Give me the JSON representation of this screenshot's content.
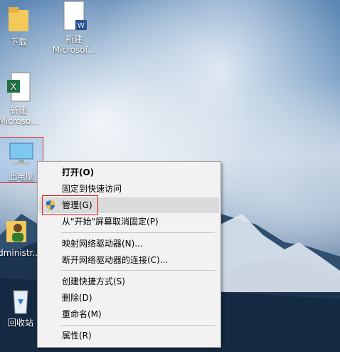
{
  "desktop": {
    "icons": [
      {
        "label": "下载",
        "kind": "folder"
      },
      {
        "label": "新建\nMicrosof...",
        "kind": "word-doc"
      },
      {
        "label": "新建\nMicroso...",
        "kind": "excel-doc"
      },
      {
        "label": "此电脑",
        "kind": "computer",
        "selected": true
      },
      {
        "label": "Administr...",
        "kind": "user-folder"
      },
      {
        "label": "回收站",
        "kind": "recycle-bin"
      }
    ]
  },
  "context_menu": {
    "items": [
      {
        "label": "打开(O)",
        "bold": true
      },
      {
        "label": "固定到快速访问"
      },
      {
        "label": "管理(G)",
        "icon": "shield-icon",
        "hovered": true
      },
      {
        "label": "从\"开始\"屏幕取消固定(P)"
      },
      {
        "label": "映射网络驱动器(N)..."
      },
      {
        "label": "断开网络驱动器的连接(C)..."
      },
      {
        "label": "创建快捷方式(S)"
      },
      {
        "label": "删除(D)"
      },
      {
        "label": "重命名(M)"
      },
      {
        "label": "属性(R)"
      }
    ]
  },
  "colors": {
    "highlight": "#e02020",
    "hover": "#dadada"
  }
}
